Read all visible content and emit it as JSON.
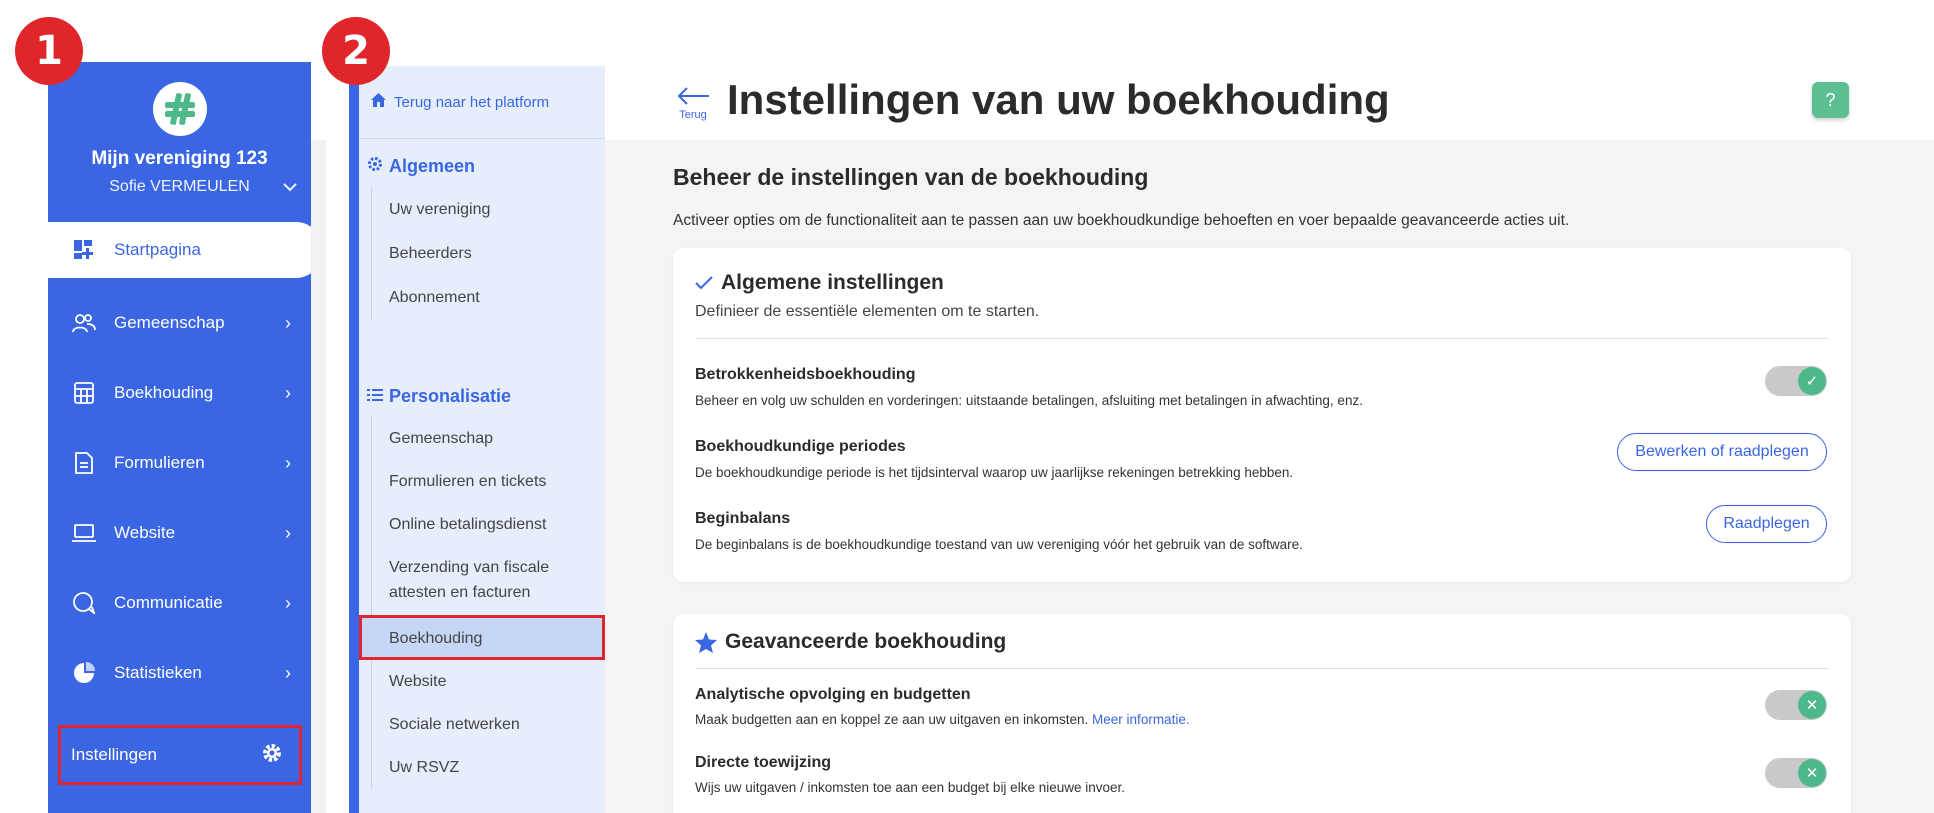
{
  "markers": {
    "m1": "1",
    "m2": "2"
  },
  "sidebar": {
    "org_name": "Mijn vereniging 123",
    "user_name": "Sofie VERMEULEN",
    "items": [
      {
        "label": "Startpagina",
        "icon": "dashboard-icon"
      },
      {
        "label": "Gemeenschap",
        "icon": "community-icon"
      },
      {
        "label": "Boekhouding",
        "icon": "calculator-icon"
      },
      {
        "label": "Formulieren",
        "icon": "document-icon"
      },
      {
        "label": "Website",
        "icon": "laptop-icon"
      },
      {
        "label": "Communicatie",
        "icon": "chat-icon"
      },
      {
        "label": "Statistieken",
        "icon": "pie-chart-icon"
      }
    ],
    "settings_label": "Instellingen"
  },
  "subnav": {
    "back_label": "Terug naar het platform",
    "section1": {
      "title": "Algemeen",
      "items": [
        "Uw vereniging",
        "Beheerders",
        "Abonnement"
      ]
    },
    "section2": {
      "title": "Personalisatie",
      "items": [
        "Gemeenschap",
        "Formulieren en tickets",
        "Online betalingsdienst",
        "Verzending van fiscale attesten en facturen",
        "Boekhouding",
        "Website",
        "Sociale netwerken",
        "Uw RSVZ"
      ]
    }
  },
  "header": {
    "back_label": "Terug",
    "title": "Instellingen van uw boekhouding",
    "help": "?"
  },
  "main": {
    "heading": "Beheer de instellingen van de boekhouding",
    "intro": "Activeer opties om de functionaliteit aan te passen aan uw boekhoudkundige behoeften en voer bepaalde geavanceerde acties uit.",
    "card1": {
      "title": "Algemene instellingen",
      "subtitle": "Definieer de essentiële elementen om te starten.",
      "rows": [
        {
          "title": "Betrokkenheidsboekhouding",
          "desc": "Beheer en volg uw schulden en vorderingen: uitstaande betalingen, afsluiting met betalingen in afwachting, enz.",
          "toggle": "on"
        },
        {
          "title": "Boekhoudkundige periodes",
          "desc": "De boekhoudkundige periode is het tijdsinterval waarop uw jaarlijkse rekeningen betrekking hebben.",
          "button": "Bewerken of raadplegen"
        },
        {
          "title": "Beginbalans",
          "desc": "De beginbalans is de boekhoudkundige toestand van uw vereniging vóór het gebruik van de software.",
          "button": "Raadplegen"
        }
      ]
    },
    "card2": {
      "title": "Geavanceerde boekhouding",
      "rows": [
        {
          "title": "Analytische opvolging en budgetten",
          "desc": "Maak budgetten aan en koppel ze aan uw uitgaven en inkomsten.",
          "link": "Meer informatie.",
          "toggle": "off"
        },
        {
          "title": "Directe toewijzing",
          "desc": "Wijs uw uitgaven / inkomsten toe aan een budget bij elke nieuwe invoer.",
          "toggle": "off"
        }
      ]
    }
  },
  "colors": {
    "brand": "#3a66e3",
    "marker": "#e0262b",
    "toggle_on": "#4db98b",
    "help": "#5cbf92"
  }
}
